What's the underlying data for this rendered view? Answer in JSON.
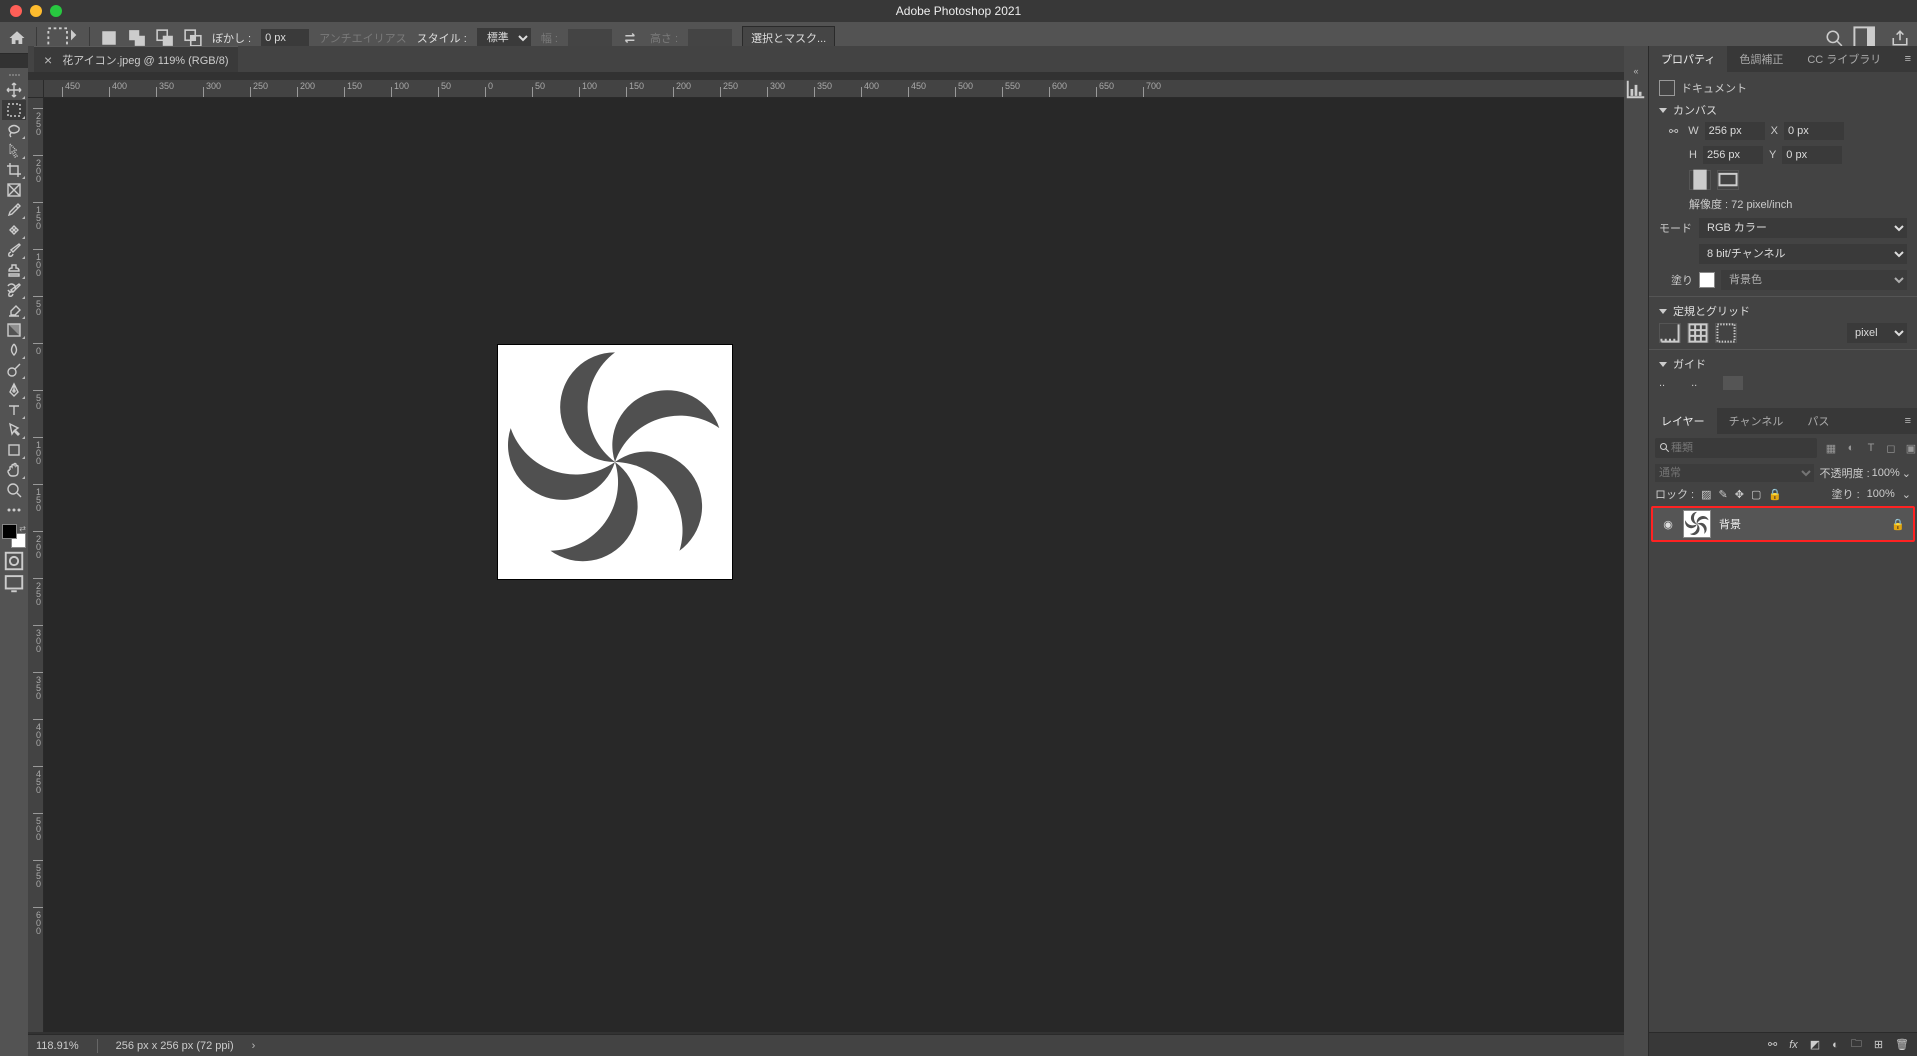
{
  "title": "Adobe Photoshop 2021",
  "doc_tab": {
    "name": "花アイコン.jpeg @ 119% (RGB/8)"
  },
  "option_bar": {
    "feather_label": "ぼかし :",
    "feather_value": "0 px",
    "anti_alias": "アンチエイリアス",
    "style_label": "スタイル :",
    "style_value": "標準",
    "width_label": "幅 :",
    "height_label": "高さ :",
    "mask_button": "選択とマスク..."
  },
  "ruler_h": [
    "-450",
    "-400",
    "-350",
    "-300",
    "-250",
    "-200",
    "-150",
    "-100",
    "-50",
    "0",
    "50",
    "100",
    "150",
    "200",
    "250",
    "300",
    "350",
    "400",
    "450",
    "500",
    "550",
    "600",
    "650",
    "700"
  ],
  "ruler_v": [
    "-250",
    "-200",
    "-150",
    "-100",
    "-50",
    "0",
    "50",
    "100",
    "150",
    "200",
    "250",
    "300",
    "350",
    "400",
    "450",
    "500",
    "550",
    "600"
  ],
  "panels": {
    "prop_tabs": {
      "properties": "プロパティ",
      "adjust": "色調補正",
      "cc_lib": "CC ライブラリ"
    },
    "doc_label": "ドキュメント",
    "canvas_label": "カンバス",
    "w_label": "W",
    "w_value": "256 px",
    "x_label": "X",
    "x_value": "0 px",
    "h_label": "H",
    "h_value": "256 px",
    "y_label": "Y",
    "y_value": "0 px",
    "resolution": "解像度 : 72 pixel/inch",
    "mode_label": "モード",
    "mode_value": "RGB カラー",
    "depth_value": "8 bit/チャンネル",
    "fill_label": "塗り",
    "fill_value": "背景色",
    "ruler_grid_label": "定規とグリッド",
    "unit_value": "pixel",
    "guides_label": "ガイド",
    "layer_tabs": {
      "layers": "レイヤー",
      "channels": "チャンネル",
      "paths": "パス"
    },
    "kind_placeholder": "種類",
    "blend_value": "通常",
    "opacity_label": "不透明度 :",
    "opacity_value": "100%",
    "lock_label": "ロック :",
    "fill_pct_label": "塗り :",
    "fill_pct_value": "100%",
    "layer_name": "背景"
  },
  "status": {
    "zoom": "118.91%",
    "size": "256 px x 256 px (72 ppi)"
  }
}
